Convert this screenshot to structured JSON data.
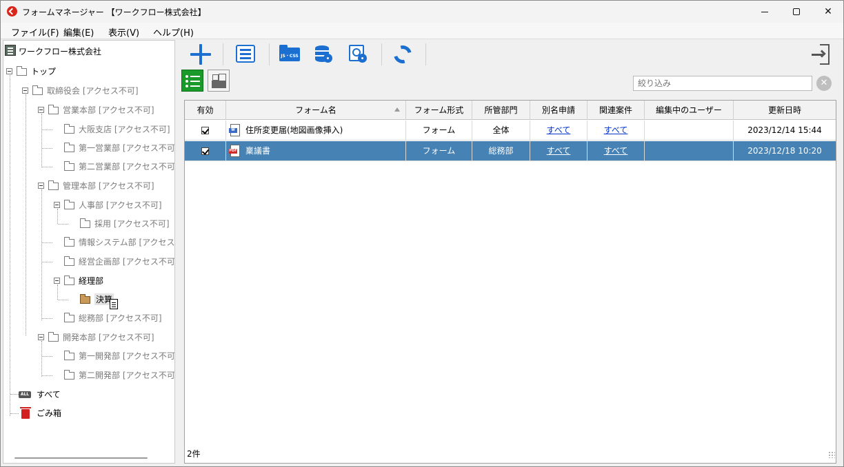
{
  "window": {
    "title": "フォームマネージャー 【ワークフロー株式会社】"
  },
  "menu": [
    "ファイル(F)",
    "編集(E)",
    "表示(V)",
    "ヘルプ(H)"
  ],
  "tree": {
    "root": "ワークフロー株式会社",
    "top": "トップ",
    "nodes": {
      "torishimari": "取締役会 [アクセス不可]",
      "eigyo_honbu": "営業本部 [アクセス不可]",
      "osaka": "大阪支店 [アクセス不可]",
      "dai1_eigyo": "第一営業部 [アクセス不可",
      "dai2_eigyo": "第二営業部 [アクセス不可",
      "kanri_honbu": "管理本部 [アクセス不可]",
      "jinji": "人事部 [アクセス不可]",
      "saiyo": "採用 [アクセス不可]",
      "joho": "情報システム部 [アクセス不",
      "keiei": "経営企画部 [アクセス不可",
      "keiri": "経理部",
      "kessan": "決算",
      "somu": "総務部 [アクセス不可]",
      "kaihatsu_honbu": "開発本部 [アクセス不可]",
      "dai1_kaihatsu": "第一開発部 [アクセス不可",
      "dai2_kaihatsu": "第二開発部 [アクセス不可"
    },
    "all": "すべて",
    "all_icon_text": "ALL",
    "trash": "ごみ箱"
  },
  "toolbar": {
    "jscss_label": "JS・CSS"
  },
  "filter": {
    "placeholder": "絞り込み"
  },
  "grid": {
    "headers": [
      "有効",
      "フォーム名",
      "フォーム形式",
      "所管部門",
      "別名申請",
      "関連案件",
      "編集中のユーザー",
      "更新日時"
    ],
    "rows": [
      {
        "enabled": true,
        "icon": "word-form-icon",
        "icon_text": "W",
        "name": "住所変更届(地図画像挿入)",
        "format": "フォーム",
        "dept": "全体",
        "alias": "すべて",
        "related": "すべて",
        "editing_user": "",
        "updated": "2023/12/14 15:44",
        "selected": false
      },
      {
        "enabled": true,
        "icon": "pdf-form-icon",
        "icon_text": "PDF",
        "name": "稟議書",
        "format": "フォーム",
        "dept": "総務部",
        "alias": "すべて",
        "related": "すべて",
        "editing_user": "",
        "updated": "2023/12/18 10:20",
        "selected": true
      }
    ]
  },
  "status": {
    "count": "2件"
  }
}
